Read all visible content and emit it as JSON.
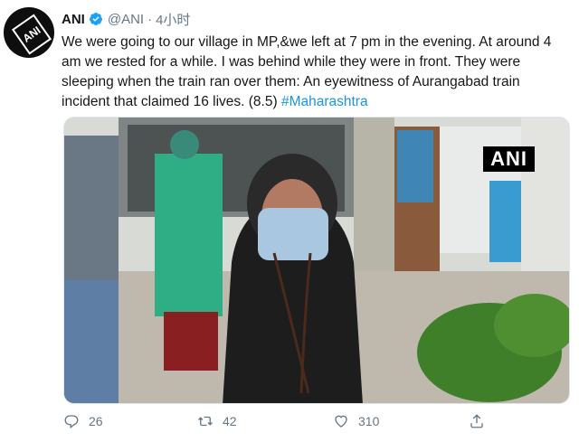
{
  "author": {
    "name": "ANI",
    "handle": "@ANI",
    "separator": "·",
    "time": "4小时",
    "avatar_logo_text": "ANI",
    "verified_icon": "verified-badge-icon"
  },
  "tweet": {
    "text": "We were going to our village in MP,&we left at 7 pm in the evening. At around 4 am we rested for a while. I was behind while they were in front. They were sleeping when the train ran over them: An eyewitness of Aurangabad train incident that claimed 16 lives. (8.5) ",
    "hashtag": "#Maharashtra"
  },
  "media": {
    "watermark": "ANI"
  },
  "actions": {
    "replies": "26",
    "retweets": "42",
    "likes": "310",
    "reply_icon": "reply-icon",
    "retweet_icon": "retweet-icon",
    "like_icon": "heart-icon",
    "share_icon": "share-icon"
  },
  "colors": {
    "link": "#1b95e0",
    "secondary_text": "#657786",
    "verified": "#1da1f2"
  }
}
